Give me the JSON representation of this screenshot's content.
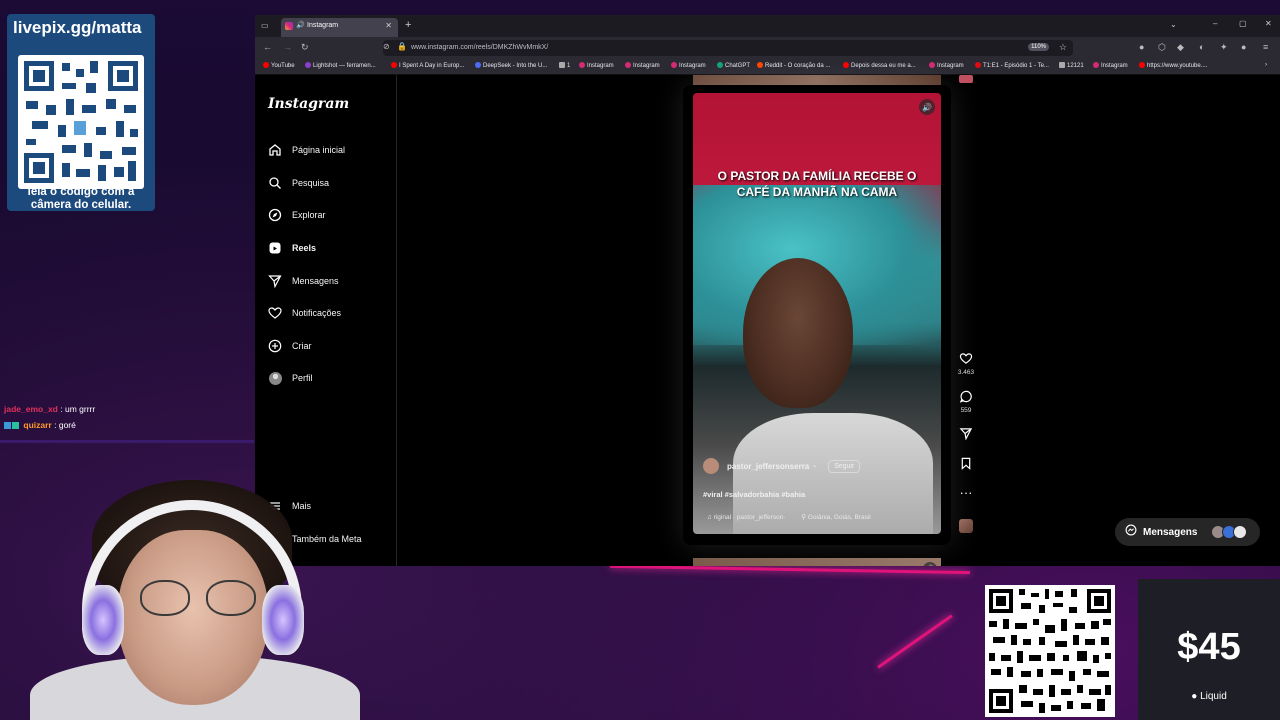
{
  "overlay": {
    "donation_url": "livepix.gg/matta",
    "qr_caption_line1": "leia o código com a",
    "qr_caption_line2": "câmera do celular.",
    "amount": "$45",
    "amount_sub": "Liquid"
  },
  "chat": [
    {
      "user": "jade_emo_xd",
      "sep": ":",
      "text": "um grrrr"
    },
    {
      "user": "quizarr",
      "sep": ":",
      "text": "goré"
    }
  ],
  "browser": {
    "tab_title": "Instagram",
    "url": "www.instagram.com/reels/DMKZhWvMmkX/",
    "zoom": "110%",
    "bookmarks": [
      "YouTube",
      "Lightshot — ferramen...",
      "I Spent A Day in Europ...",
      "DeepSeek - Into the U...",
      "1",
      "Instagram",
      "Instagram",
      "Instagram",
      "ChatGPT",
      "Reddit - O coração da ...",
      "Depois dessa eu me a...",
      "Instagram",
      "T1:E1 - Episódio 1 - Te...",
      "12121",
      "Instagram",
      "https://www.youtube...."
    ]
  },
  "instagram": {
    "logo": "Instagram",
    "nav": [
      {
        "label": "Página inicial",
        "icon": "home-icon"
      },
      {
        "label": "Pesquisa",
        "icon": "search-icon"
      },
      {
        "label": "Explorar",
        "icon": "compass-icon"
      },
      {
        "label": "Reels",
        "icon": "reels-icon"
      },
      {
        "label": "Mensagens",
        "icon": "send-icon"
      },
      {
        "label": "Notificações",
        "icon": "heart-icon"
      },
      {
        "label": "Criar",
        "icon": "plus-icon"
      },
      {
        "label": "Perfil",
        "icon": "avatar-icon"
      }
    ],
    "more": "Mais",
    "meta": "Também da Meta",
    "reel": {
      "caption_line1": "O PASTOR DA FAMÍLIA RECEBE O",
      "caption_line2": "CAFÉ DA MANHÃ NA CAMA",
      "username": "pastor_jeffersonserra",
      "dot": "•",
      "follow": "Seguir",
      "tags": "#viral #salvadorbahia #bahia",
      "audio": "♫ riginal · pastor_jefferson·",
      "location": "Goiânia, Goiás, Brasil"
    },
    "actions": {
      "likes": "3.463",
      "comments": "559"
    },
    "messages_label": "Mensagens"
  }
}
